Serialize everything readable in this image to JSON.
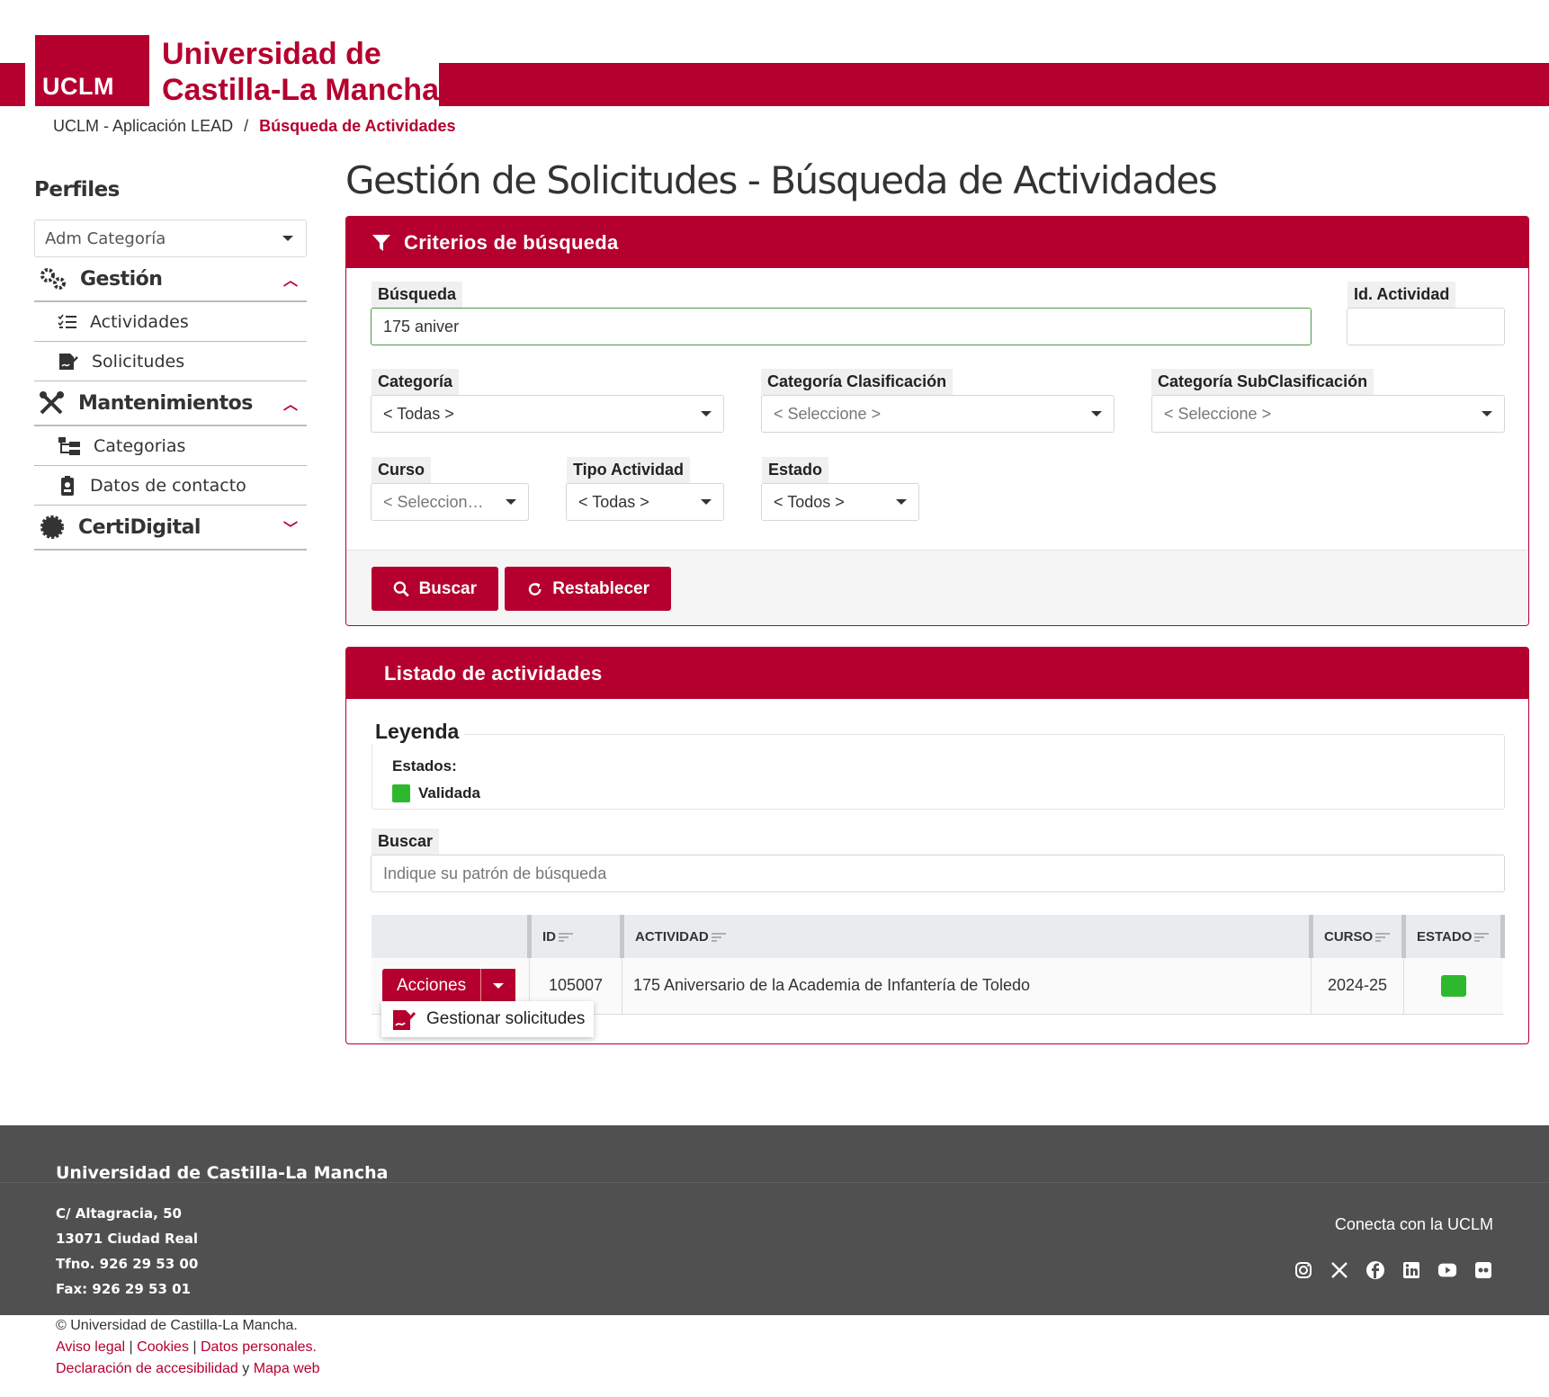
{
  "brand": {
    "logo_text": "UCLM",
    "name_line1": "Universidad de",
    "name_line2": "Castilla-La Mancha",
    "color": "#b5002f"
  },
  "breadcrumb": {
    "home": "UCLM - Aplicación LEAD",
    "separator": "/",
    "current": "Búsqueda de Actividades"
  },
  "sidebar": {
    "title": "Perfiles",
    "profile_select": "Adm Categoría",
    "groups": [
      {
        "label": "Gestión",
        "icon": "gears-icon",
        "expanded": true,
        "items": [
          {
            "label": "Actividades",
            "icon": "list-check-icon"
          },
          {
            "label": "Solicitudes",
            "icon": "signature-icon"
          }
        ]
      },
      {
        "label": "Mantenimientos",
        "icon": "tools-icon",
        "expanded": true,
        "items": [
          {
            "label": "Categorias",
            "icon": "tree-icon"
          },
          {
            "label": "Datos de contacto",
            "icon": "badge-icon"
          }
        ]
      },
      {
        "label": "CertiDigital",
        "icon": "certificate-icon",
        "expanded": false,
        "items": []
      }
    ]
  },
  "page_title": "Gestión de Solicitudes - Búsqueda de Actividades",
  "search_card": {
    "header": "Criterios de búsqueda",
    "busqueda": {
      "label": "Búsqueda",
      "value": "175 aniver"
    },
    "id_actividad": {
      "label": "Id. Actividad",
      "value": ""
    },
    "categoria": {
      "label": "Categoría",
      "value": "< Todas >"
    },
    "categoria_clasificacion": {
      "label": "Categoría Clasificación",
      "value": "< Seleccione >"
    },
    "categoria_subclasificacion": {
      "label": "Categoría SubClasificación",
      "value": "< Seleccione >"
    },
    "curso": {
      "label": "Curso",
      "value": "< Seleccion…"
    },
    "tipo_actividad": {
      "label": "Tipo Actividad",
      "value": "< Todas >"
    },
    "estado": {
      "label": "Estado",
      "value": "< Todos >"
    },
    "buscar_button": "Buscar",
    "restablecer_button": "Restablecer"
  },
  "list_card": {
    "header": "Listado de actividades",
    "legend_title": "Leyenda",
    "estados_label": "Estados:",
    "legend_items": [
      {
        "label": "Validada",
        "color": "#2eb82e"
      }
    ],
    "buscar_label": "Buscar",
    "buscar_placeholder": "Indique su patrón de búsqueda",
    "columns": [
      "ID",
      "ACTIVIDAD",
      "CURSO",
      "ESTADO"
    ],
    "rows": [
      {
        "id": "105007",
        "actividad": "175 Aniversario de la Academia de Infantería de Toledo",
        "curso": "2024-25",
        "estado_color": "#2eb82e"
      }
    ],
    "acciones_label": "Acciones",
    "dropdown_item": "Gestionar solicitudes"
  },
  "footer": {
    "university": "Universidad de Castilla-La Mancha",
    "address1": "C/ Altagracia, 50",
    "address2": "13071 Ciudad Real",
    "phone": "Tfno. 926 29 53 00",
    "fax": "Fax: 926 29 53 01",
    "conecta": "Conecta con la UCLM",
    "social": [
      "instagram-icon",
      "x-icon",
      "facebook-icon",
      "linkedin-icon",
      "youtube-icon",
      "flickr-icon"
    ],
    "copyright": "© Universidad de Castilla-La Mancha.",
    "aviso_legal": "Aviso legal",
    "cookies": "Cookies",
    "datos_personales": "Datos personales.",
    "accesibilidad": "Declaración de accesibilidad",
    "y": "y",
    "mapa_web": "Mapa web"
  }
}
